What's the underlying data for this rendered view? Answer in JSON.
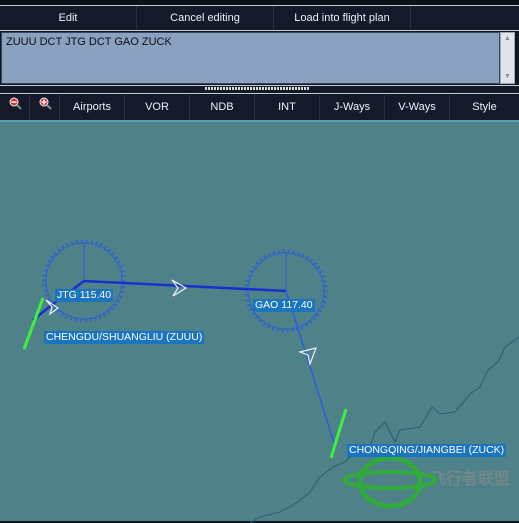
{
  "editor": {
    "buttons": [
      "Edit",
      "Cancel editing",
      "Load into flight plan"
    ],
    "route_text": "ZUUU DCT JTG DCT GAO ZUCK"
  },
  "map_toolbar": {
    "icons": [
      "zoom-out-icon",
      "zoom-in-icon"
    ],
    "items": [
      "Airports",
      "VOR",
      "NDB",
      "INT",
      "J-Ways",
      "V-Ways",
      "Style"
    ]
  },
  "map": {
    "background": "#4f8188",
    "route_color": "#1a2fd0",
    "vor_color": "#2a5ee0",
    "runway_color": "#3cf03c",
    "labels": {
      "jtg": "JTG 115.40",
      "gao": "GAO 117.40",
      "origin": "CHENGDU/SHUANGLIU (ZUUU)",
      "destination": "CHONGQING/JIANGBEI (ZUCK)"
    },
    "watermark": "飞行者联盟"
  }
}
